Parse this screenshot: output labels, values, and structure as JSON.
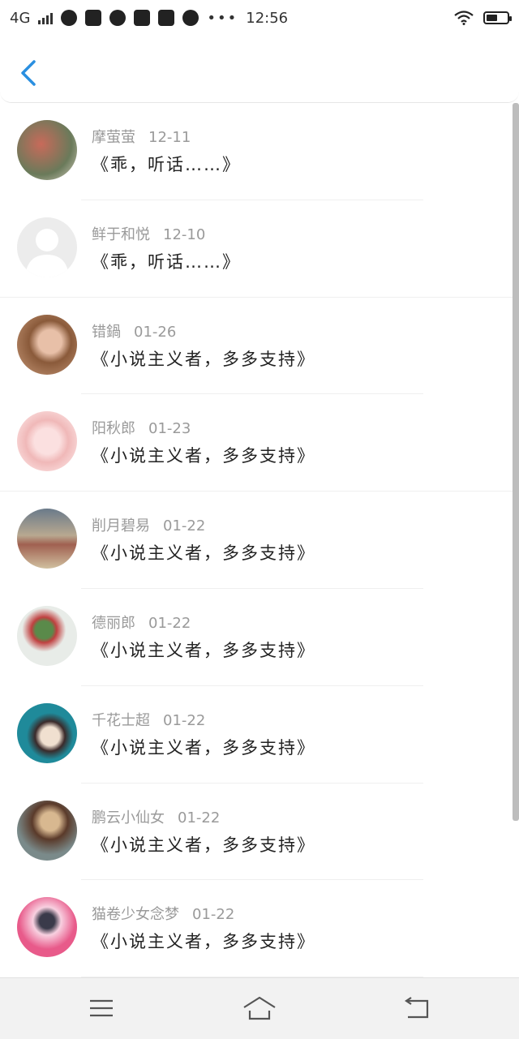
{
  "status_bar": {
    "network": "4G",
    "time": "12:56"
  },
  "header": {
    "back_icon": "chevron-left-icon"
  },
  "comments": [
    {
      "name": "摩萤萤",
      "date": "12-11",
      "message": "《乖，听话……》",
      "avatar_color": "#9a7a6a"
    },
    {
      "name": "鲜于和悦",
      "date": "12-10",
      "message": "《乖，听话……》",
      "avatar_color": "#e3e3e3"
    },
    {
      "name": "错鍋",
      "date": "01-26",
      "message": "《小说主义者，多多支持》",
      "avatar_color": "#b07a5a"
    },
    {
      "name": "阳秋郎",
      "date": "01-23",
      "message": "《小说主义者，多多支持》",
      "avatar_color": "#f0c8c8"
    },
    {
      "name": "削月碧易",
      "date": "01-22",
      "message": "《小说主义者，多多支持》",
      "avatar_color": "#8a6a5a"
    },
    {
      "name": "德丽郎",
      "date": "01-22",
      "message": "《小说主义者，多多支持》",
      "avatar_color": "#d8e0d8"
    },
    {
      "name": "千花士超",
      "date": "01-22",
      "message": "《小说主义者，多多支持》",
      "avatar_color": "#2a7a8a"
    },
    {
      "name": "鹏云小仙女",
      "date": "01-22",
      "message": "《小说主义者，多多支持》",
      "avatar_color": "#6a5040"
    },
    {
      "name": "猫卷少女念梦",
      "date": "01-22",
      "message": "《小说主义者，多多支持》",
      "avatar_color": "#e85a8a"
    }
  ],
  "navbar": {
    "menu_icon": "menu-icon",
    "home_icon": "home-icon",
    "back_icon": "return-icon"
  },
  "colors": {
    "accent": "#2a8fe0",
    "name_text": "#9a9a9a",
    "message_text": "#222222"
  }
}
